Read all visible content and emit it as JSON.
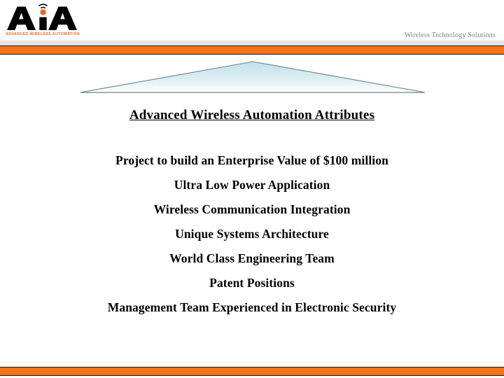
{
  "slide": {
    "brand": {
      "logo_text": "AiA",
      "logo_icon": "wireless-signal-icon",
      "tagline": "ADVANCED WIRELESS AUTOMATION",
      "logo_color": "#F26522",
      "logo_text_color": "#000000"
    },
    "header": {
      "right_tagline": "Wireless Technology Solutions",
      "tagline_color": "#808080",
      "accent_bar_color": "#F4741B",
      "gray_band_color": "#E3E3E3"
    },
    "graphic": {
      "name": "mountain-triangle-shape",
      "fill_top": "#BFE0E8",
      "fill_bottom": "#FFFFFF",
      "outline": "#6E8389"
    },
    "title": "Advanced Wireless Automation Attributes",
    "bullets": [
      "Project to build an Enterprise Value of $100 million",
      "Ultra Low Power Application",
      "Wireless Communication Integration",
      "Unique Systems Architecture",
      "World Class Engineering Team",
      "Patent Positions",
      "Management Team Experienced in Electronic Security"
    ]
  }
}
